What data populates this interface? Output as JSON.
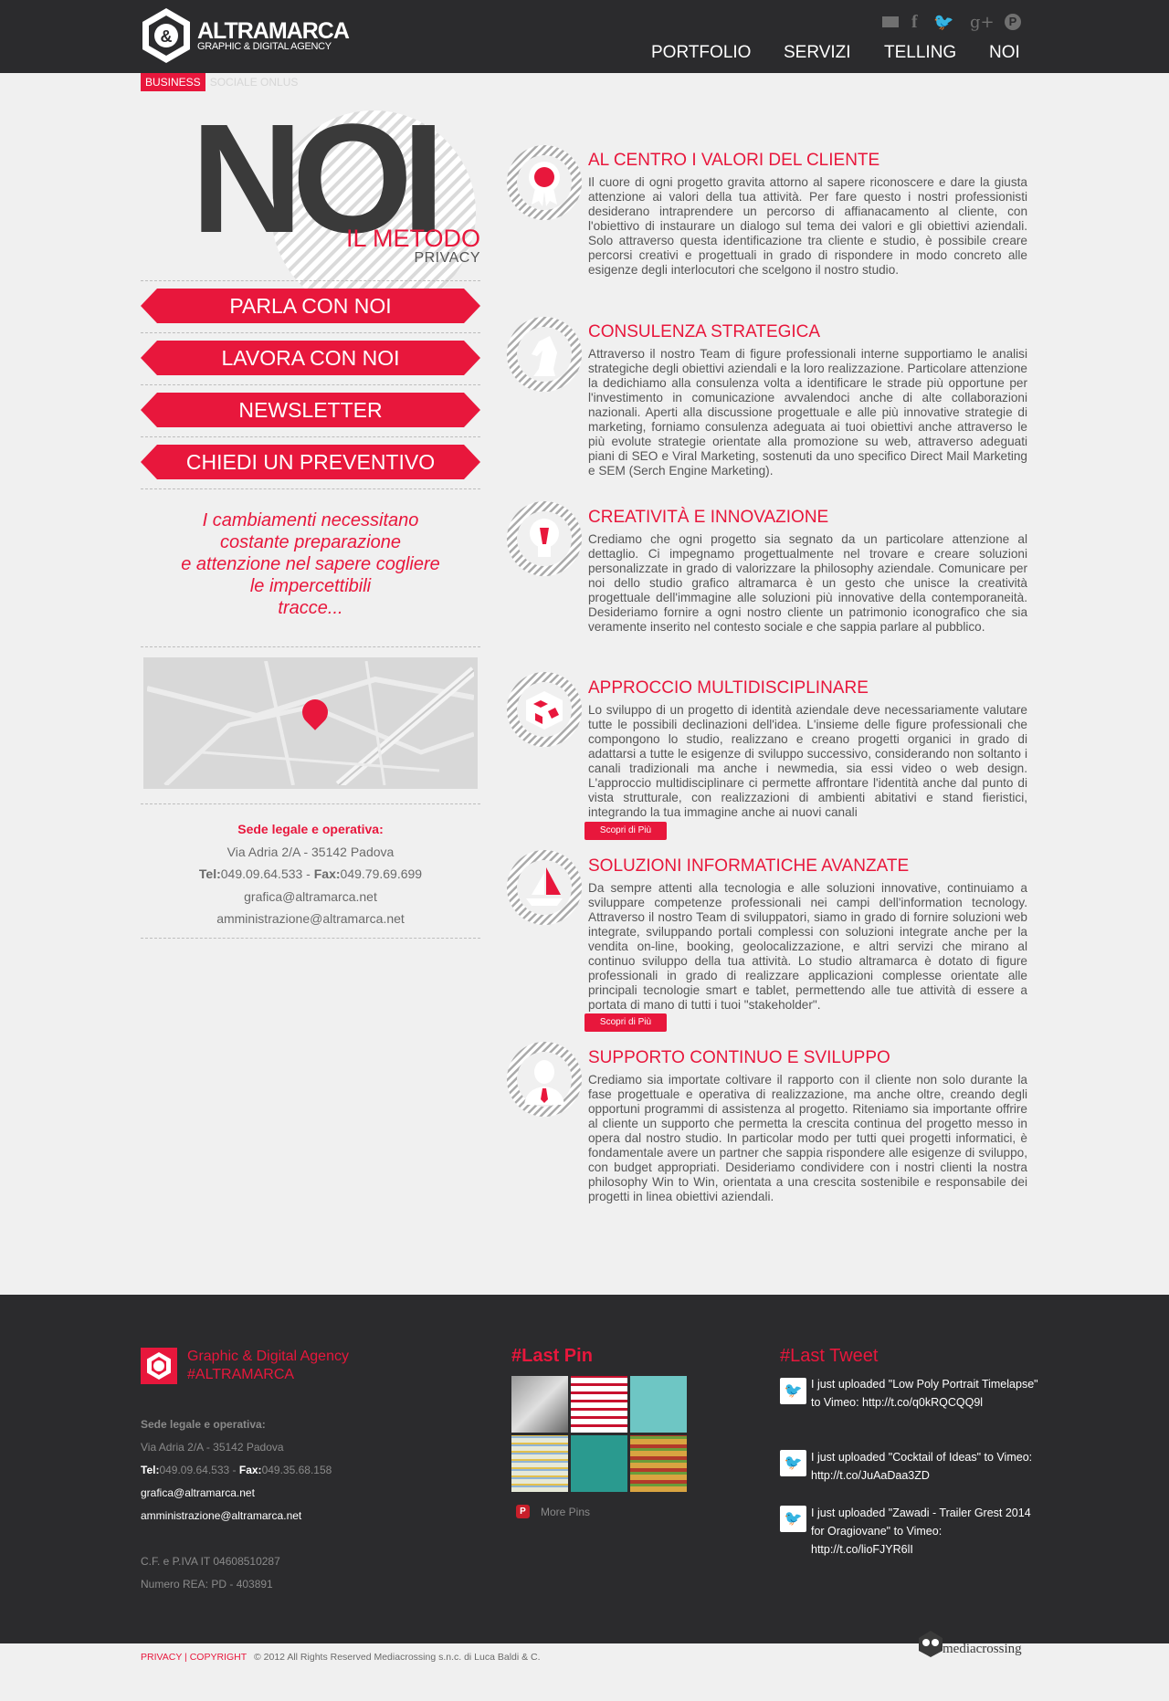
{
  "brand": {
    "name": "ALTRAMARCA",
    "tagline": "GRAPHIC & DIGITAL AGENCY",
    "accent": "#e8173c",
    "dark": "#2b2b2d"
  },
  "social": [
    "mail-icon",
    "facebook-icon",
    "twitter-icon",
    "googleplus-icon",
    "pinterest-icon"
  ],
  "nav": {
    "portfolio": "PORTFOLIO",
    "servizi": "SERVIZI",
    "telling": "TELLING",
    "noi": "NOI"
  },
  "subtabs": {
    "business": "BUSINESS",
    "sociale": "SOCIALE ONLUS"
  },
  "hero": {
    "big": "NOI",
    "metodo": "IL METODO",
    "privacy": "PRIVACY"
  },
  "buttons": {
    "parla": "PARLA CON NOI",
    "lavora": "LAVORA CON NOI",
    "newsletter": "NEWSLETTER",
    "preventivo": "CHIEDI UN PREVENTIVO"
  },
  "quote": {
    "l1": "I cambiamenti necessitano",
    "l2": "costante preparazione",
    "l3": "e attenzione nel sapere cogliere",
    "l4": "le impercettibili",
    "l5": "tracce..."
  },
  "address": {
    "title": "Sede legale e operativa:",
    "street": "Via Adria 2/A - 35142 Padova",
    "tel_label": "Tel:",
    "tel": "049.09.64.533",
    "sep": " - ",
    "fax_label": "Fax:",
    "fax": "049.79.69.699",
    "email1": "grafica@altramarca.net",
    "email2": "amministrazione@altramarca.net"
  },
  "services": [
    {
      "title": "AL CENTRO I VALORI DEL CLIENTE",
      "icon": "award-ribbon-icon",
      "text": "Il cuore di ogni progetto gravita attorno al sapere riconoscere e dare la giusta attenzione ai valori della tua attività. Per fare questo i nostri professionisti desiderano intraprendere un percorso di affianacamento al cliente, con l'obiettivo di instaurare un dialogo sul tema dei valori e gli obiettivi aziendali. Solo attraverso questa identificazione tra cliente e studio, è possibile creare percorsi creativi e progettuali in grado di rispondere in modo concreto alle esigenze degli interlocutori che scelgono il nostro studio."
    },
    {
      "title": "CONSULENZA STRATEGICA",
      "icon": "chess-knight-icon",
      "text": "Attraverso il nostro Team di figure professionali interne supportiamo le analisi strategiche degli obiettivi aziendali e la loro realizzazione. Particolare attenzione la dedichiamo alla consulenza volta a identificare le strade più opportune per l'investimento in comunicazione avvalendoci anche di alte collaborazioni nazionali. Aperti alla discussione progettuale e alle più innovative strategie di marketing, forniamo consulenza adeguata ai tuoi obiettivi anche attraverso le più evolute strategie orientate alla promozione su web, attraverso adeguati piani di SEO e Viral Marketing, sostenuti da uno specifico Direct Mail Marketing e SEM (Serch Engine Marketing)."
    },
    {
      "title": "CREATIVITÀ E INNOVAZIONE",
      "icon": "lightbulb-icon",
      "text": "Crediamo che ogni progetto sia segnato da un particolare attenzione al dettaglio. Ci impegnamo progettualmente nel trovare e creare soluzioni personalizzate in grado di valorizzare la philosophy aziendale. Comunicare per noi dello studio grafico altramarca è un gesto che unisce la creatività progettuale dell'immagine alle soluzioni più innovative della contemporaneità. Desideriamo fornire a ogni nostro cliente un patrimonio iconografico che sia veramente inserito nel contesto sociale e che sappia parlare al pubblico."
    },
    {
      "title": "APPROCCIO MULTIDISCIPLINARE",
      "icon": "cube-icon",
      "text": "Lo sviluppo di un progetto di identità aziendale deve necessariamente valutare tutte le possibili declinazioni dell'idea. L'insieme delle figure professionali che compongono lo studio, realizzano e creano progetti organici in grado di adattarsi a tutte le esigenze di sviluppo successivo, considerando non soltanto i canali tradizionali ma anche i newmedia, sia essi video o web design. L'approccio multidisciplinare ci permette affrontare l'identità anche dal punto di vista strutturale, con realizzazioni di ambienti abitativi e stand fieristici, integrando la tua immagine anche ai nuovi canali",
      "more": "Scopri di Più"
    },
    {
      "title": "SOLUZIONI INFORMATICHE AVANZATE",
      "icon": "sailboat-icon",
      "text": "Da sempre attenti alla tecnologia e alle soluzioni innovative, continuiamo a sviluppare competenze professionali nei campi dell'information tecnology. Attraverso il nostro Team di sviluppatori, siamo in grado di fornire soluzioni web integrate, sviluppando portali complessi con soluzioni integrate anche per la vendita on-line, booking, geolocalizzazione, e altri servizi che mirano al continuo sviluppo della tua attività. Lo studio altramarca è dotato di figure professionali in grado di realizzare applicazioni complesse orientate alle principali tecnologie smart e tablet, permettendo alle tue attività di essere a portata di mano di tutti i tuoi \"stakeholder\".",
      "more": "Scopri di Più"
    },
    {
      "title": "SUPPORTO CONTINUO E SVILUPPO",
      "icon": "businessman-icon",
      "text": "Crediamo sia importate coltivare il rapporto con il cliente non solo durante la fase progettuale e operativa di realizzazione, ma anche oltre, creando degli opportuni programmi di assistenza al progetto. Riteniamo sia importante offrire al cliente un supporto che permetta la crescita continua del progetto messo in opera dal nostro studio. In particolar modo per tutti quei progetti informatici, è fondamentale avere un partner che sappia rispondere alle esigenze di sviluppo, con budget appropriati. Desideriamo condividere con i nostri clienti la nostra philosophy Win to Win, orientata a una crescita sostenibile e responsabile dei progetti in linea obiettivi aziendali."
    }
  ],
  "footer": {
    "title1": "Graphic & Digital Agency",
    "title2": "#ALTRAMARCA",
    "sede": "Sede legale e operativa:",
    "street": "Via Adria 2/A - 35142 Padova",
    "tel_label": "Tel:",
    "tel": "049.09.64.533",
    "sep": " - ",
    "fax_label": "Fax:",
    "fax": "049.35.68.158",
    "email1": "grafica@altramarca.net",
    "email2": "amministrazione@altramarca.net",
    "piva": "C.F. e P.IVA IT 04608510287",
    "rea": "Numero REA: PD - 403891",
    "pins_title": "#Last Pin",
    "more_pins": "More Pins",
    "tweets_title": "#Last Tweet",
    "tweets": [
      "I just uploaded \"Low Poly Portrait Timelapse\" to Vimeo: http://t.co/q0kRQCQQ9l",
      "I just uploaded \"Cocktail of Ideas\" to Vimeo: http://t.co/JuAaDaa3ZD",
      "I just uploaded \"Zawadi - Trailer Grest 2014 for Oragiovane\" to Vimeo: http://t.co/lioFJYR6lI"
    ]
  },
  "bottom": {
    "privacy": "PRIVACY",
    "sep": " | ",
    "copyright": "COPYRIGHT",
    "copy": "© 2012 All Rights Reserved Mediacrossing s.n.c. di Luca Baldi & C.",
    "partner": "mediacrossing"
  }
}
